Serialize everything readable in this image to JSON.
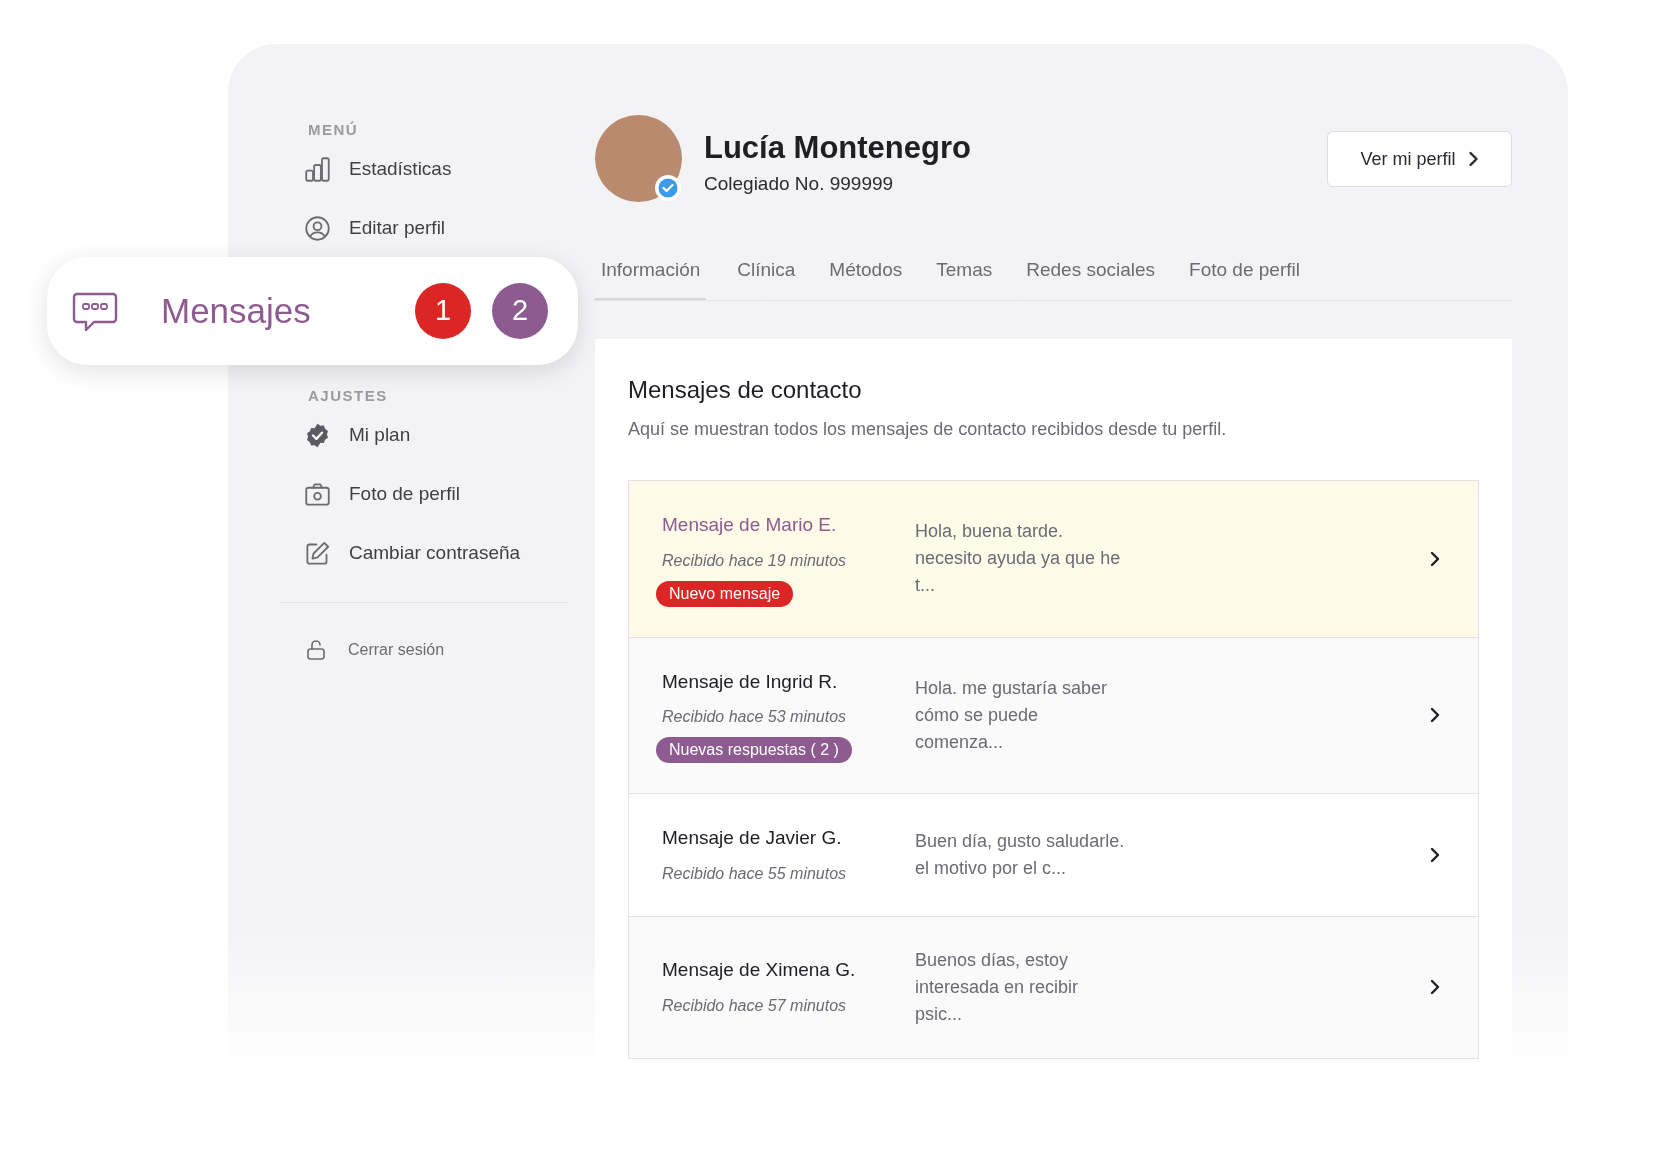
{
  "sidebar": {
    "sections": [
      {
        "heading": "MENÚ",
        "items": [
          {
            "label": "Estadísticas"
          },
          {
            "label": "Editar perfil"
          }
        ]
      },
      {
        "heading": "AJUSTES",
        "items": [
          {
            "label": "Mi plan"
          },
          {
            "label": "Foto de perfil"
          },
          {
            "label": "Cambiar contraseña"
          }
        ]
      }
    ],
    "logout": {
      "label": "Cerrar sesión"
    }
  },
  "highlighted_item": {
    "label": "Mensajes",
    "badges": [
      {
        "text": "1",
        "color": "#dc2626"
      },
      {
        "text": "2",
        "color": "#8e5b91"
      }
    ]
  },
  "profile": {
    "name": "Lucía Montenegro",
    "subtitle": "Colegiado No. 999999",
    "verified": true,
    "button": "Ver mi perfil"
  },
  "tabs": [
    {
      "label": "Información",
      "selected": true
    },
    {
      "label": "Clínica",
      "selected": false
    },
    {
      "label": "Métodos",
      "selected": false
    },
    {
      "label": "Temas",
      "selected": false
    },
    {
      "label": "Redes sociales",
      "selected": false
    },
    {
      "label": "Foto de perfil",
      "selected": false
    }
  ],
  "messages_panel": {
    "title": "Mensajes de contacto",
    "description": "Aquí se muestran todos los mensajes de contacto recibidos desde tu perfil.",
    "messages": [
      {
        "sender": "Mensaje de Mario E.",
        "received": "Recibido hace 19 minutos",
        "badge": {
          "kind": "new",
          "text": "Nuevo mensaje"
        },
        "highlighted": true,
        "preview": [
          "Hola, buena tarde.",
          "necesito ayuda ya que he",
          "t..."
        ]
      },
      {
        "sender": "Mensaje de Ingrid R.",
        "received": "Recibido hace 53 minutos",
        "badge": {
          "kind": "replies",
          "text": "Nuevas respuestas ( 2 )"
        },
        "highlighted": false,
        "preview": [
          "Hola. me gustaría saber",
          "cómo se puede",
          "comenza..."
        ]
      },
      {
        "sender": "Mensaje de Javier G.",
        "received": "Recibido hace 55 minutos",
        "highlighted": false,
        "preview": [
          "Buen día, gusto saludarle.",
          "el motivo por el c..."
        ]
      },
      {
        "sender": "Mensaje de Ximena G.",
        "received": "Recibido hace 57 minutos",
        "highlighted": false,
        "preview": [
          "Buenos días, estoy",
          "interesada en recibir",
          "psic..."
        ]
      }
    ]
  }
}
